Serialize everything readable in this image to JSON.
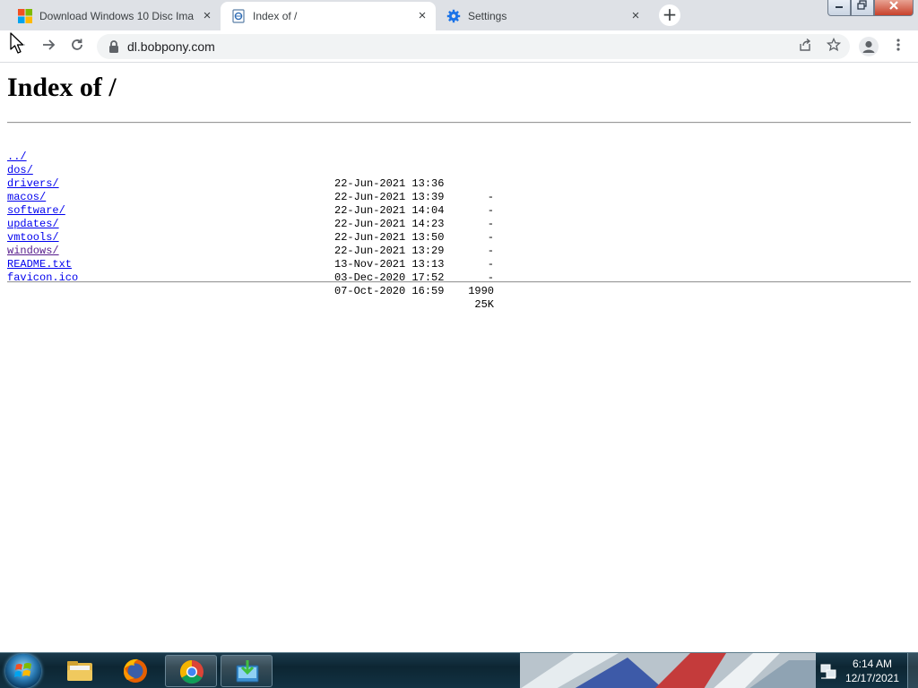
{
  "browser": {
    "tabs": [
      {
        "title": "Download Windows 10 Disc Ima",
        "icon": "windows-logo-icon",
        "active": false
      },
      {
        "title": "Index of /",
        "icon": "document-page-icon",
        "active": true
      },
      {
        "title": "Settings",
        "icon": "settings-gear-icon",
        "active": false
      }
    ],
    "new_tab_label": "+",
    "tab_close_label": "×",
    "address_url": "dl.bobpony.com"
  },
  "page": {
    "heading": "Index of /",
    "entries": [
      {
        "name": "../",
        "date": "",
        "size": ""
      },
      {
        "name": "dos/",
        "date": "22-Jun-2021 13:36",
        "size": "-"
      },
      {
        "name": "drivers/",
        "date": "22-Jun-2021 13:39",
        "size": "-"
      },
      {
        "name": "macos/",
        "date": "22-Jun-2021 14:04",
        "size": "-"
      },
      {
        "name": "software/",
        "date": "22-Jun-2021 14:23",
        "size": "-"
      },
      {
        "name": "updates/",
        "date": "22-Jun-2021 13:50",
        "size": "-"
      },
      {
        "name": "vmtools/",
        "date": "22-Jun-2021 13:29",
        "size": "-"
      },
      {
        "name": "windows/",
        "date": "13-Nov-2021 13:13",
        "size": "-"
      },
      {
        "name": "README.txt",
        "date": "03-Dec-2020 17:52",
        "size": "1990"
      },
      {
        "name": "favicon.ico",
        "date": "07-Oct-2020 16:59",
        "size": "25K"
      }
    ],
    "link_color": "#0000ee",
    "visited_link_color": "#551a8b"
  },
  "taskbar": {
    "apps": [
      {
        "icon": "file-explorer-icon"
      },
      {
        "icon": "firefox-icon"
      },
      {
        "icon": "chrome-icon"
      },
      {
        "icon": "downloader-app-icon"
      }
    ],
    "clock_time": "6:14 AM",
    "clock_date": "12/17/2021"
  }
}
